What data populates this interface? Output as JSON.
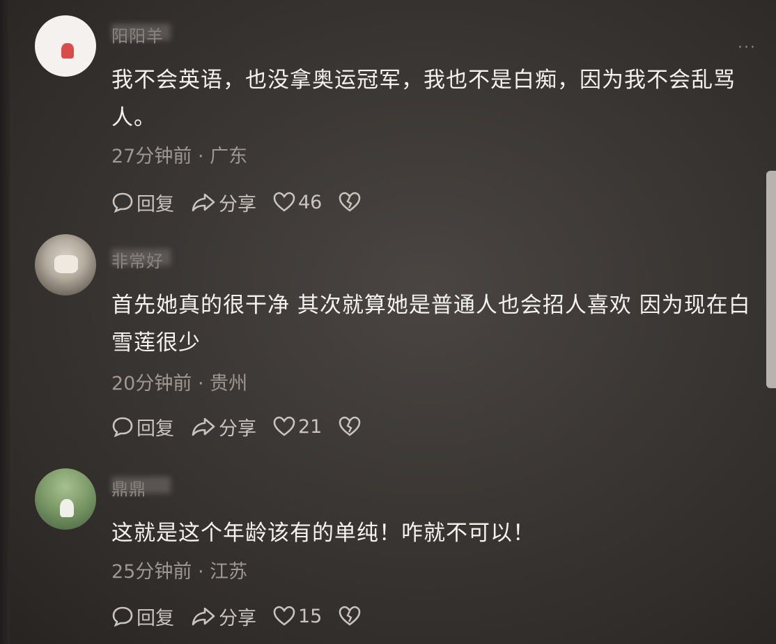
{
  "comments": [
    {
      "username": "阳阳羊",
      "text": "我不会英语，也没拿奥运冠军，我也不是白痴，因为我不会乱骂人。",
      "time": "27分钟前",
      "location": "广东",
      "reply_label": "回复",
      "share_label": "分享",
      "likes": "46"
    },
    {
      "username": "非常好",
      "text": "首先她真的很干净  其次就算她是普通人也会招人喜欢  因为现在白雪莲很少",
      "time": "20分钟前",
      "location": "贵州",
      "reply_label": "回复",
      "share_label": "分享",
      "likes": "21"
    },
    {
      "username": "鼎鼎",
      "text": "这就是这个年龄该有的单纯！咋就不可以！",
      "time": "25分钟前",
      "location": "江苏",
      "reply_label": "回复",
      "share_label": "分享",
      "likes": "15"
    }
  ],
  "separator": "·",
  "more_glyph": "···",
  "icons": {
    "reply": "speech-bubble-icon",
    "share": "share-arrow-icon",
    "like": "heart-icon",
    "dislike": "broken-heart-icon"
  }
}
